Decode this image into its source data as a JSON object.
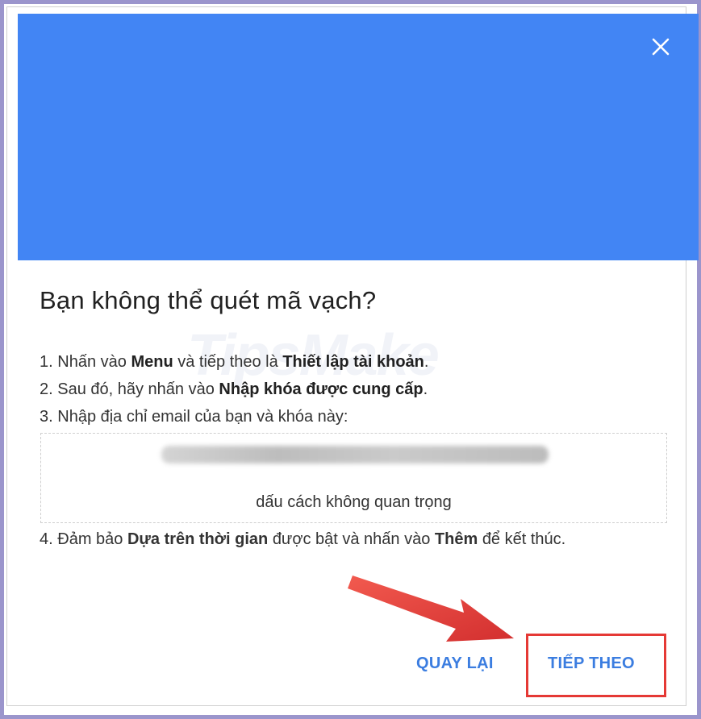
{
  "dialog": {
    "title": "Bạn không thể quét mã vạch?",
    "close_icon": "close-icon",
    "header_color": "#4285f4",
    "watermark": "TipsMake"
  },
  "steps": [
    {
      "number": "1.",
      "before": "Nhấn vào",
      "bold1": "Menu",
      "middle": "và tiếp theo là",
      "bold2": "Thiết lập tài khoản",
      "after": "."
    },
    {
      "number": "2.",
      "before": "Sau đó, hãy nhấn vào",
      "bold1": "Nhập khóa được cung cấp",
      "after": "."
    },
    {
      "number": "3.",
      "text": "Nhập địa chỉ email của bạn và khóa này:"
    },
    {
      "number": "4.",
      "before": "Đảm bảo",
      "bold1": "Dựa trên thời gian",
      "middle": "được bật và nhấn vào",
      "bold2": "Thêm",
      "after": "để kết thúc."
    }
  ],
  "key_box": {
    "note": "dấu cách không quan trọng"
  },
  "buttons": {
    "back_label": "QUAY LẠI",
    "next_label": "TIẾP THEO",
    "color": "#3b7de0"
  },
  "annotation": {
    "arrow_color": "#e53935",
    "highlight_color": "#e53935"
  }
}
